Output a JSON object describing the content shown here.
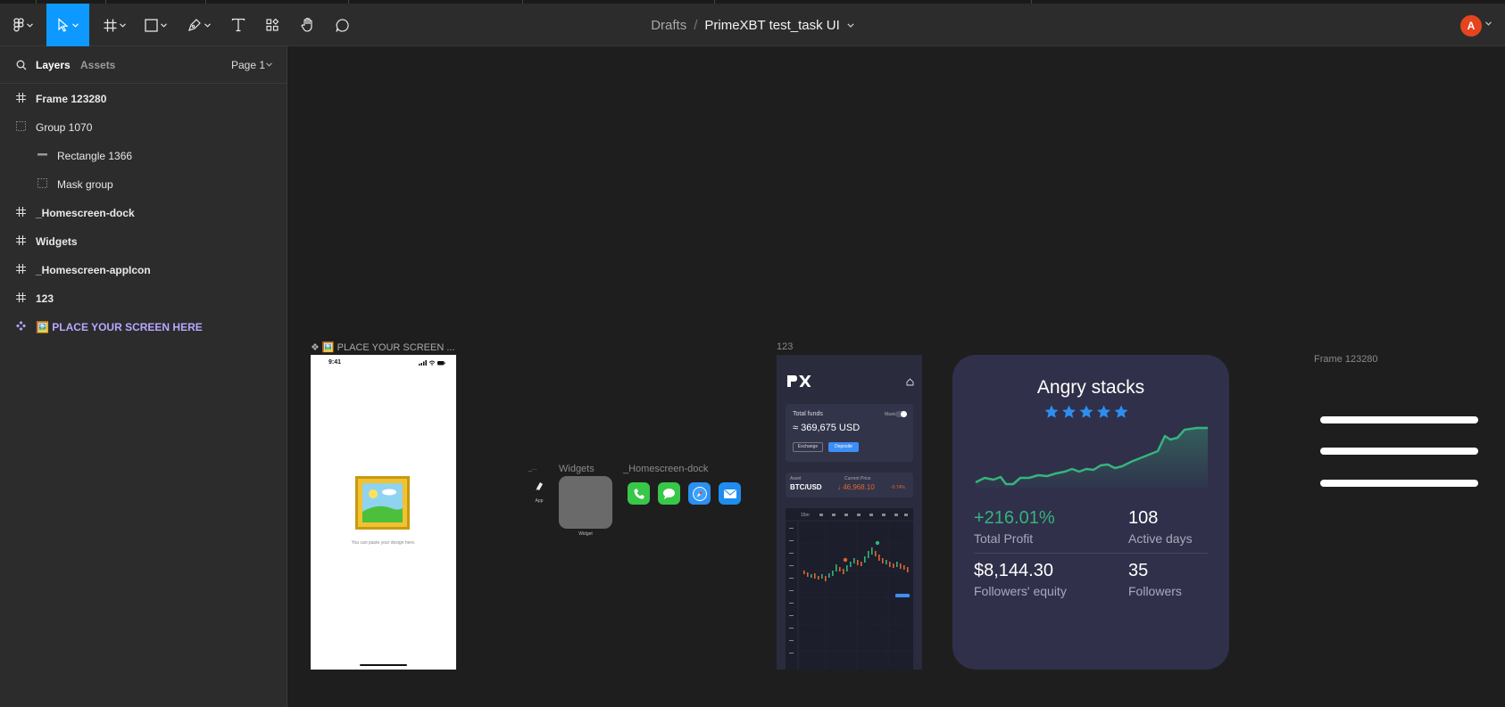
{
  "toolbar": {
    "tools": [
      "main-menu",
      "move",
      "frame",
      "shape",
      "pen",
      "text",
      "resources",
      "hand",
      "comment"
    ],
    "active_tool": "move",
    "accent": "#0d99ff"
  },
  "breadcrumb": {
    "folder": "Drafts",
    "separator": "/",
    "file": "PrimeXBT test_task UI"
  },
  "user": {
    "initial": "A",
    "color": "#e5441f"
  },
  "panel": {
    "tab_layers": "Layers",
    "tab_assets": "Assets",
    "page": "Page 1"
  },
  "layers": [
    {
      "name": "Frame 123280",
      "icon": "frame-icon"
    },
    {
      "name": "Group 1070",
      "icon": "group-icon"
    },
    {
      "name": "Rectangle 1366",
      "icon": "rectangle-icon"
    },
    {
      "name": "Mask group",
      "icon": "group-icon"
    },
    {
      "name": "_Homescreen-dock",
      "icon": "frame-icon"
    },
    {
      "name": "Widgets",
      "icon": "frame-icon"
    },
    {
      "name": "_Homescreen-appIcon",
      "icon": "frame-icon"
    },
    {
      "name": "123",
      "icon": "frame-icon"
    },
    {
      "name": "🖼️ PLACE YOUR SCREEN HERE",
      "icon": "component-icon",
      "color": "#b9a7ff"
    }
  ],
  "canvas": {
    "labels": {
      "place_screen": "❖ 🖼️ PLACE YOUR SCREEN ...",
      "app_icon": "_...",
      "widgets": "Widgets",
      "dock": "_Homescreen-dock",
      "px_frame": "123",
      "frame_123280": "Frame 123280"
    },
    "phone": {
      "time": "9:41",
      "hint": "You can paste your design here."
    },
    "app_icon_caption": "App",
    "widget_caption": "Widget",
    "dock_icons": [
      "phone-icon",
      "messages-icon",
      "safari-icon",
      "mail-icon"
    ],
    "px": {
      "total_funds_label": "Total funds",
      "mask_label": "Mask",
      "total_funds_value": "≈ 369,675 USD",
      "exchange_button": "Exchange",
      "deposit_button": "Deposite",
      "asset_label": "Asset",
      "asset_value": "BTC/USD",
      "price_label": "Current Price",
      "price_value": "↓ 46,968.10",
      "price_change": "-0.74%",
      "interval": "15m"
    },
    "stats": {
      "title": "Angry stacks",
      "rating": 5,
      "profit_value": "+216.01%",
      "profit_label": "Total Profit",
      "days_value": "108",
      "days_label": "Active days",
      "equity_value": "$8,144.30",
      "equity_label": "Followers' equity",
      "followers_value": "35",
      "followers_label": "Followers",
      "accent": "#36b37e"
    }
  }
}
